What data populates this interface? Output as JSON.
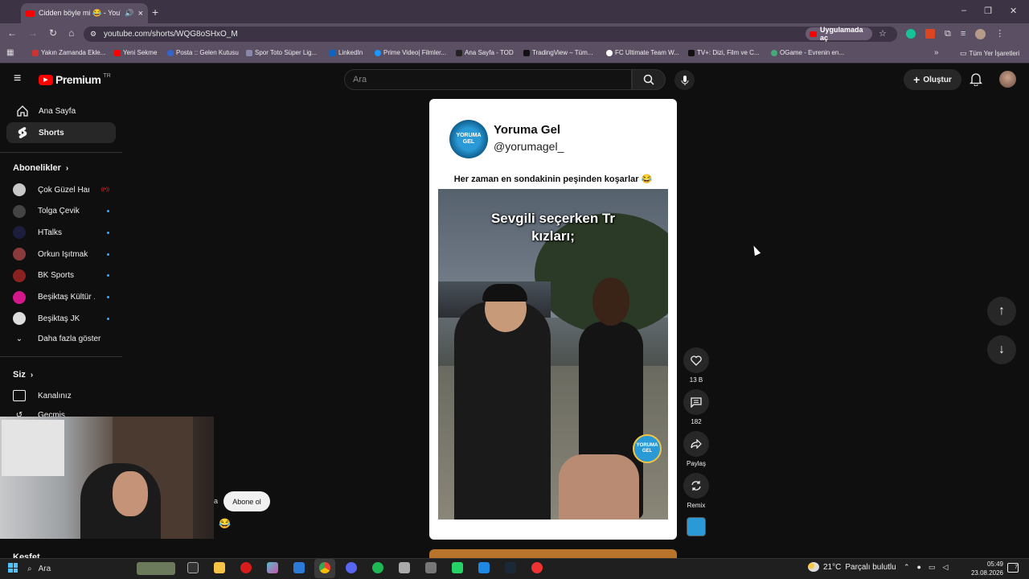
{
  "browser": {
    "tab_title": "Cidden böyle mi 😂 - YouTube",
    "url": "youtube.com/shorts/WQG8oSHxO_M",
    "open_in_app": "Uygulamada aç",
    "bookmarks": [
      "Yakın Zamanda Ekle...",
      "Yeni Sekme",
      "Posta :: Gelen Kutusu",
      "Spor Toto Süper Lig...",
      "LinkedIn",
      "Prime Video| Filmler...",
      "Ana Sayfa - TOD",
      "TradingView – Tüm...",
      "FC Ultimate Team W...",
      "TV+: Dizi, Film ve C...",
      "OGame - Evrenin en..."
    ],
    "all_bookmarks": "Tüm Yer İşaretleri"
  },
  "youtube": {
    "logo": "Premium",
    "logo_badge": "TR",
    "search_placeholder": "Ara",
    "create_label": "Oluştur",
    "nav": {
      "home": "Ana Sayfa",
      "shorts": "Shorts"
    },
    "subscriptions_title": "Abonelikler",
    "subscriptions": [
      {
        "name": "Çok Güzel Harek...",
        "color": "#c7c7c7",
        "live": true
      },
      {
        "name": "Tolga Çevik",
        "color": "#444444",
        "live": false
      },
      {
        "name": "HTalks",
        "color": "#1c1c3c",
        "live": false
      },
      {
        "name": "Orkun Işıtmak",
        "color": "#8a3a3a",
        "live": false
      },
      {
        "name": "BK Sports",
        "color": "#8a2222",
        "live": false
      },
      {
        "name": "Beşiktaş Kültür ...",
        "color": "#d4178a",
        "live": false
      },
      {
        "name": "Beşiktaş JK",
        "color": "#dddddd",
        "live": false
      }
    ],
    "show_more": "Daha fazla göster",
    "you_title": "Siz",
    "you_items": [
      "Kanalınız",
      "Geçmiş"
    ],
    "explore_title": "Keşfet",
    "short": {
      "channel": "Yoruma Gel",
      "handle": "@yorumagel_",
      "caption": "Her zaman en sondakinin peşinden koşarlar 😂",
      "overlay_text_1": "Sevgili seçerken Tr",
      "overlay_text_2": "kızları;",
      "likes": "13 B",
      "comments": "182",
      "share": "Paylaş",
      "remix": "Remix",
      "watermark_1": "YORUMA",
      "watermark_2": "GEL"
    },
    "subscribe_label": "Abone ol",
    "subscribe_prefix": "a",
    "emoji": "😂"
  },
  "taskbar": {
    "search": "Ara",
    "weather_temp": "21°C",
    "weather_desc": "Parçalı bulutlu",
    "time": "05:49",
    "date": "23.08.2026",
    "notif": "7"
  }
}
